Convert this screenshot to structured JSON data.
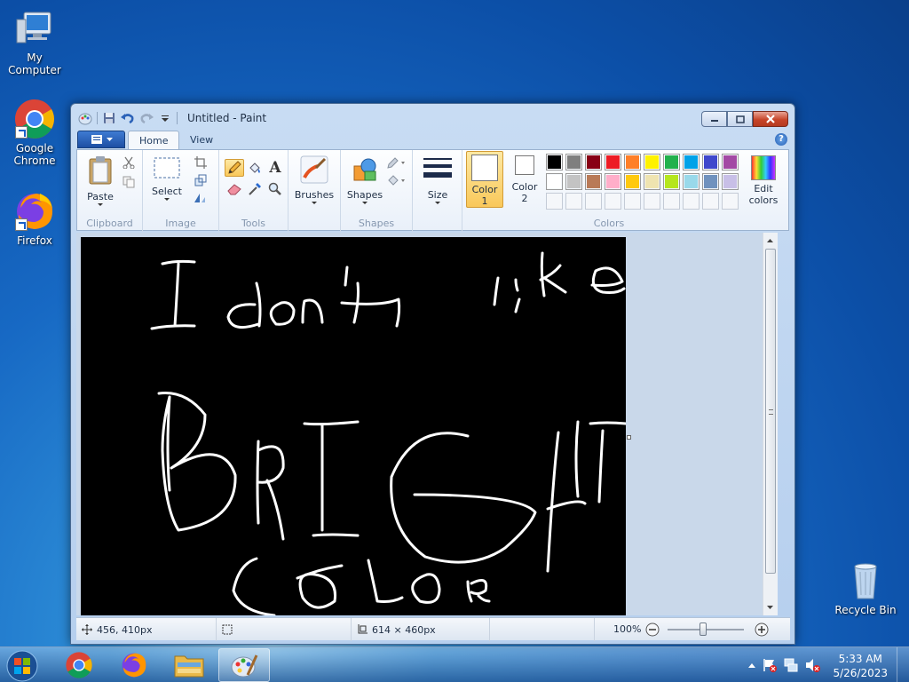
{
  "desktop": {
    "icons": [
      {
        "label": "My Computer",
        "icon": "computer-icon"
      },
      {
        "label": "Google Chrome",
        "icon": "chrome-icon"
      },
      {
        "label": "Firefox",
        "icon": "firefox-icon"
      },
      {
        "label": "Recycle Bin",
        "icon": "recycle-bin-icon"
      }
    ]
  },
  "window": {
    "title": "Untitled - Paint",
    "tabs": [
      {
        "label": "Home"
      },
      {
        "label": "View"
      }
    ],
    "ribbon": {
      "clipboard": {
        "label": "Clipboard",
        "paste": "Paste"
      },
      "image": {
        "label": "Image",
        "select": "Select"
      },
      "tools": {
        "label": "Tools"
      },
      "brushes": {
        "label": "Brushes"
      },
      "shapes": {
        "label": "Shapes",
        "button": "Shapes"
      },
      "size": {
        "label": "Size"
      },
      "color1": {
        "line1": "Color",
        "line2": "1",
        "value": "#ffffff"
      },
      "color2": {
        "line1": "Color",
        "line2": "2",
        "value": "#ffffff"
      },
      "colors": {
        "label": "Colors"
      },
      "edit_colors": {
        "line1": "Edit",
        "line2": "colors"
      },
      "palette_row1": [
        "#000000",
        "#7f7f7f",
        "#880015",
        "#ed1c24",
        "#ff7f27",
        "#fff200",
        "#22b14c",
        "#00a2e8",
        "#3f48cc",
        "#a349a4"
      ],
      "palette_row2": [
        "#ffffff",
        "#c3c3c3",
        "#b97a57",
        "#ffaec9",
        "#ffc90e",
        "#efe4b0",
        "#b5e61d",
        "#99d9ea",
        "#7092be",
        "#c8bfe7"
      ]
    },
    "canvas": {
      "background": "#000000",
      "stroke_color": "#ffffff"
    },
    "status": {
      "cursor_pos": "456, 410px",
      "image_size": "614 × 460px",
      "zoom": "100%"
    }
  },
  "taskbar": {
    "items": [
      {
        "icon": "chrome-icon"
      },
      {
        "icon": "firefox-icon"
      },
      {
        "icon": "file-explorer-icon"
      },
      {
        "icon": "paint-icon",
        "active": true
      }
    ],
    "time": "5:33 AM",
    "date": "5/26/2023"
  }
}
